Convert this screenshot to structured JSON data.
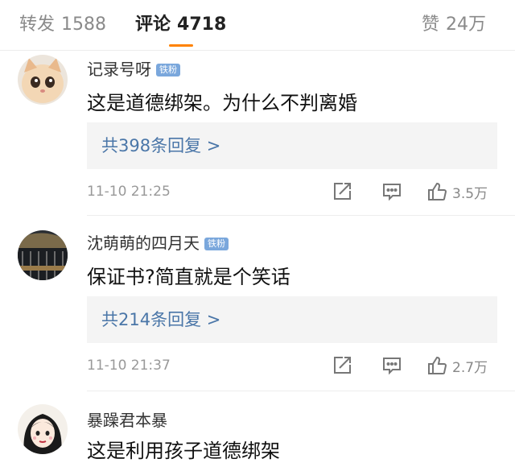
{
  "tabs": [
    {
      "label": "转发",
      "count": "1588"
    },
    {
      "label": "评论",
      "count": "4718"
    },
    {
      "label": "赞",
      "count": "24万"
    }
  ],
  "comments": [
    {
      "username": "记录号呀",
      "badge": "铁粉",
      "text": "这是道德绑架。为什么不判离婚",
      "replies": "共398条回复 >",
      "time": "11-10 21:25",
      "likes": "3.5万"
    },
    {
      "username": "沈萌萌的四月天",
      "badge": "铁粉",
      "text": "保证书?简直就是个笑话",
      "replies": "共214条回复 >",
      "time": "11-10 21:37",
      "likes": "2.7万"
    },
    {
      "username": "暴躁君本暴",
      "text": "这是利用孩子道德绑架"
    }
  ],
  "icons": {
    "share": "share-icon",
    "comment": "comment-icon",
    "like": "thumbs-up-icon"
  },
  "colors": {
    "accent": "#ff8200",
    "link": "#4a76a8",
    "badge": "#7aa7dc"
  }
}
